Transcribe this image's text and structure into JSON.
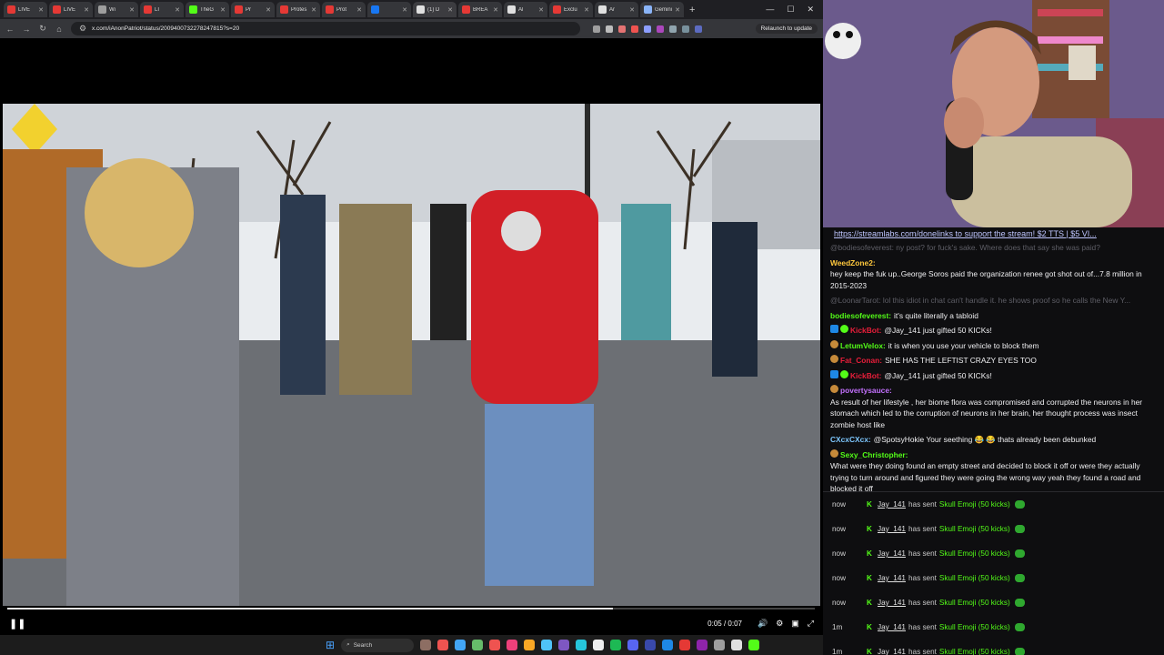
{
  "browser": {
    "tabs": [
      {
        "title": "LIVE",
        "color": "#e53935"
      },
      {
        "title": "LIVE",
        "color": "#e53935"
      },
      {
        "title": "Wi",
        "color": "#9e9e9e"
      },
      {
        "title": "LI",
        "color": "#e53935"
      },
      {
        "title": "TheG",
        "color": "#53fc18"
      },
      {
        "title": "Pr",
        "color": "#e53935"
      },
      {
        "title": "Protes",
        "color": "#e53935"
      },
      {
        "title": "Prot",
        "color": "#e53935"
      },
      {
        "title": "",
        "color": "#1877f2"
      },
      {
        "title": "(1) D",
        "color": "#e0e0e0"
      },
      {
        "title": "BREA",
        "color": "#e53935"
      },
      {
        "title": "Al",
        "color": "#e0e0e0"
      },
      {
        "title": "Exclu",
        "color": "#e53935"
      },
      {
        "title": "Ar",
        "color": "#e0e0e0"
      },
      {
        "title": "Gemini",
        "color": "#8ab4f8"
      }
    ],
    "url": "x.com/iAnonPatriot/status/2009400732278247815?s=20",
    "relaunch_label": "Relaunch to update"
  },
  "player": {
    "time": "0:05 / 0:07",
    "progress_fraction": 0.75
  },
  "taskbar": {
    "search_label": "Search"
  },
  "chat": {
    "banner": "https://streamlabs.com/donelinks to support the stream! $2 TTS | $5 VI...",
    "messages": [
      {
        "user": "",
        "text": "@bodiesofeverest: ny post? for fuck's sake. Where does that say she was paid?",
        "color": "#efeff1",
        "dim": true
      },
      {
        "user": "WeedZone2:",
        "text": "hey keep the fuk up..George Soros paid the organization renee got shot out of...7.8 million in 2015-2023",
        "color": "#ffc83d",
        "dim": false
      },
      {
        "user": "",
        "text": "@LoonarTarot: lol this idiot in chat can't handle it. he shows proof so he calls the New Y...",
        "color": "#efeff1",
        "dim": true
      },
      {
        "user": "bodiesofeverest:",
        "text": "it's quite literally a tabloid",
        "color": "#53fc18",
        "dim": false
      },
      {
        "user": "KickBot:",
        "text": "@Jay_141 just gifted 50 KICKs!",
        "color": "#e91e3a",
        "dim": false
      },
      {
        "user": "LetumVelox:",
        "text": "it is when you use your vehicle to block them",
        "color": "#53fc18",
        "dim": false
      },
      {
        "user": "Fat_Conan:",
        "text": "SHE HAS THE LEFTIST CRAZY EYES TOO",
        "color": "#e91e3a",
        "dim": false
      },
      {
        "user": "KickBot:",
        "text": "@Jay_141 just gifted 50 KICKs!",
        "color": "#e91e3a",
        "dim": false
      },
      {
        "user": "povertysauce:",
        "text": "As result of her lifestyle , her biome flora was compromised and corrupted the neurons in her stomach which led to the corruption of neurons in her brain, her thought process was insect zombie host like",
        "color": "#c471ff",
        "dim": false
      },
      {
        "user": "CXcxCXcx:",
        "text": "@SpotsyHokie Your seething 😂 😂 thats already been debunked",
        "color": "#7ec8ff",
        "dim": false
      },
      {
        "user": "Sexy_Christopher:",
        "text": "What were they doing found an empty street and decided to block it off or were they actually trying to turn around and figured they were going the wrong way yeah they found a road and blocked it off",
        "color": "#53fc18",
        "dim": false
      },
      {
        "user": "KickBot:",
        "text": "@Jay_141 just gifted 50 KICKs!",
        "color": "#e91e3a",
        "dim": false
      }
    ]
  },
  "feed": [
    {
      "time": "now",
      "name": "Jay_141",
      "action": "has sent",
      "gift": "Skull Emoji (50 kicks)"
    },
    {
      "time": "now",
      "name": "Jay_141",
      "action": "has sent",
      "gift": "Skull Emoji (50 kicks)"
    },
    {
      "time": "now",
      "name": "Jay_141",
      "action": "has sent",
      "gift": "Skull Emoji (50 kicks)"
    },
    {
      "time": "now",
      "name": "Jay_141",
      "action": "has sent",
      "gift": "Skull Emoji (50 kicks)"
    },
    {
      "time": "now",
      "name": "Jay_141",
      "action": "has sent",
      "gift": "Skull Emoji (50 kicks)"
    },
    {
      "time": "1m",
      "name": "Jay_141",
      "action": "has sent",
      "gift": "Skull Emoji (50 kicks)"
    },
    {
      "time": "1m",
      "name": "Jay_141",
      "action": "has sent",
      "gift": "Skull Emoji (50 kicks)"
    }
  ]
}
